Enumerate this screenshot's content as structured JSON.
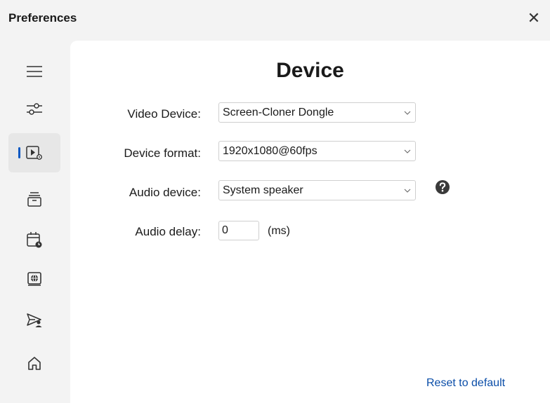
{
  "window": {
    "title": "Preferences",
    "close_glyph": "✕"
  },
  "sidebar": {
    "items": [
      {
        "icon": "menu-icon",
        "active": false
      },
      {
        "icon": "sliders-icon",
        "active": false
      },
      {
        "icon": "video-device-icon",
        "active": true
      },
      {
        "icon": "archive-icon",
        "active": false
      },
      {
        "icon": "calendar-clock-icon",
        "active": false
      },
      {
        "icon": "web-display-icon",
        "active": false
      },
      {
        "icon": "send-user-icon",
        "active": false
      },
      {
        "icon": "home-icon",
        "active": false
      }
    ]
  },
  "main": {
    "title": "Device",
    "video_device": {
      "label": "Video Device:",
      "value": "Screen-Cloner Dongle"
    },
    "device_format": {
      "label": "Device format:",
      "value": "1920x1080@60fps"
    },
    "audio_device": {
      "label": "Audio device:",
      "value": "System speaker"
    },
    "audio_delay": {
      "label": "Audio delay:",
      "value": "0",
      "unit": "(ms)"
    },
    "reset_label": "Reset to default"
  },
  "colors": {
    "accent": "#0a58c2",
    "link": "#0a4da8",
    "background": "#f3f3f3",
    "panel": "#ffffff"
  }
}
